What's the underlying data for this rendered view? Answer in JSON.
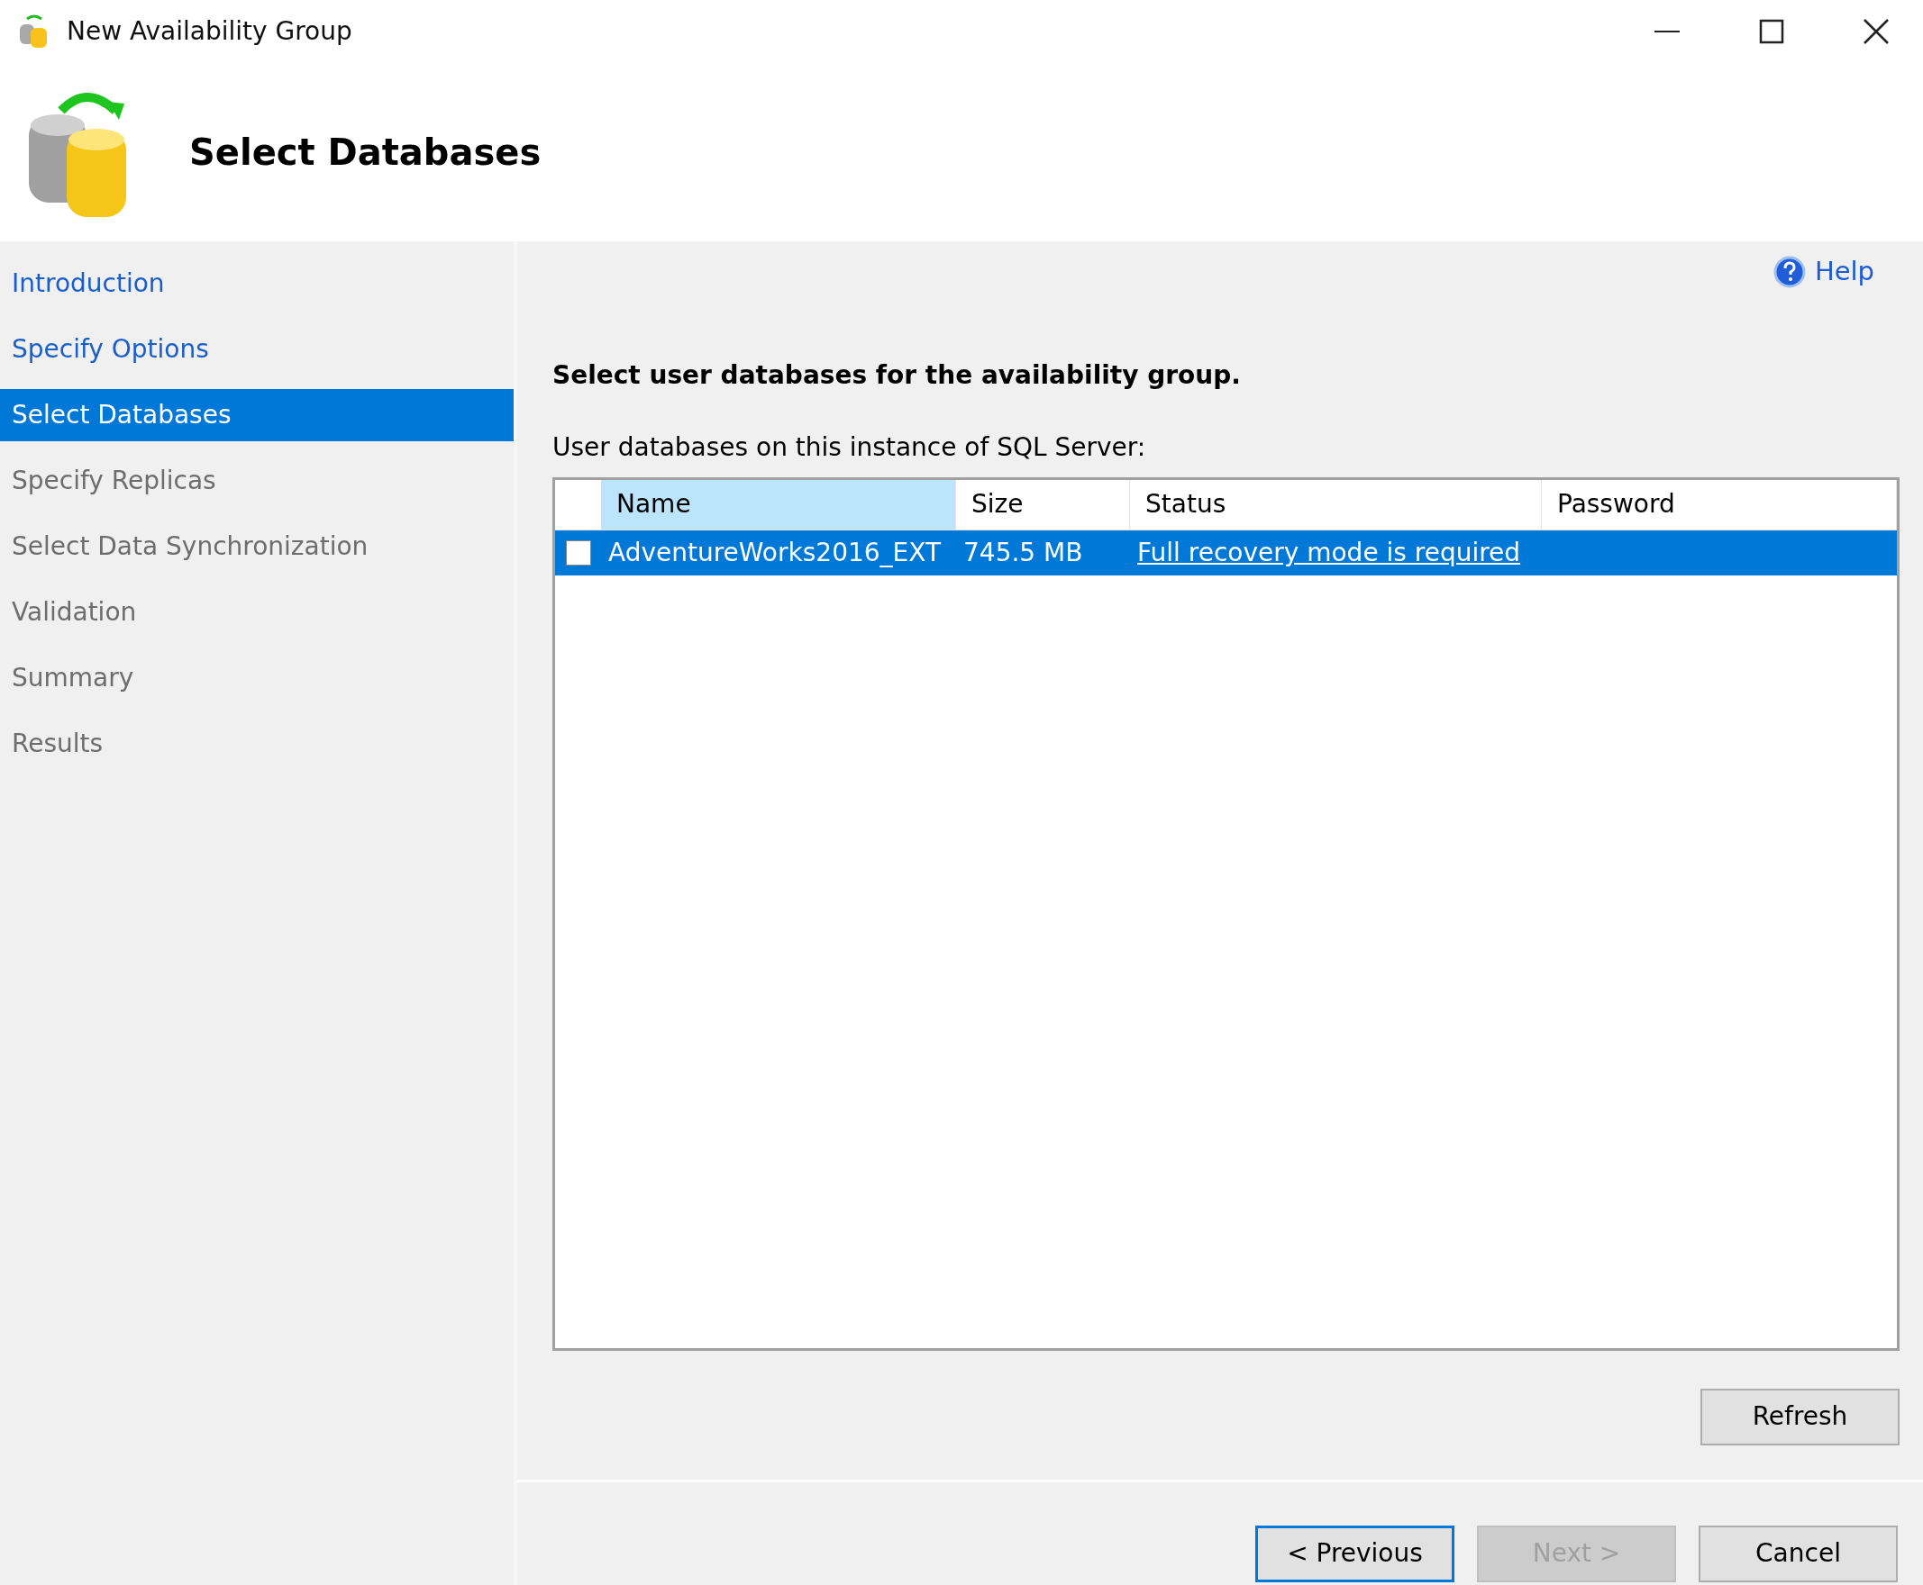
{
  "window": {
    "title": "New Availability Group"
  },
  "header": {
    "title": "Select Databases"
  },
  "sidebar": {
    "items": [
      {
        "label": "Introduction",
        "selected": false,
        "disabled": false
      },
      {
        "label": "Specify Options",
        "selected": false,
        "disabled": false
      },
      {
        "label": "Select Databases",
        "selected": true,
        "disabled": false
      },
      {
        "label": "Specify Replicas",
        "selected": false,
        "disabled": true
      },
      {
        "label": "Select Data Synchronization",
        "selected": false,
        "disabled": true
      },
      {
        "label": "Validation",
        "selected": false,
        "disabled": true
      },
      {
        "label": "Summary",
        "selected": false,
        "disabled": true
      },
      {
        "label": "Results",
        "selected": false,
        "disabled": true
      }
    ]
  },
  "help": "Help",
  "heading": "Select user databases for the availability group.",
  "table_label": "User databases on this instance of SQL Server:",
  "table": {
    "columns": [
      {
        "label": "Name",
        "sorted": true
      },
      {
        "label": "Size",
        "sorted": false
      },
      {
        "label": "Status",
        "sorted": false
      },
      {
        "label": "Password",
        "sorted": false
      }
    ],
    "rows": [
      {
        "checked": false,
        "selected": true,
        "name": "AdventureWorks2016_EXT",
        "size": "745.5 MB",
        "status": "Full recovery mode is required",
        "password": ""
      }
    ]
  },
  "refresh_button": "Refresh",
  "buttons": [
    {
      "label": "< Previous",
      "disabled": false,
      "focused": true
    },
    {
      "label": "Next >",
      "disabled": true,
      "focused": false
    },
    {
      "label": "Cancel",
      "disabled": false,
      "focused": false
    }
  ]
}
